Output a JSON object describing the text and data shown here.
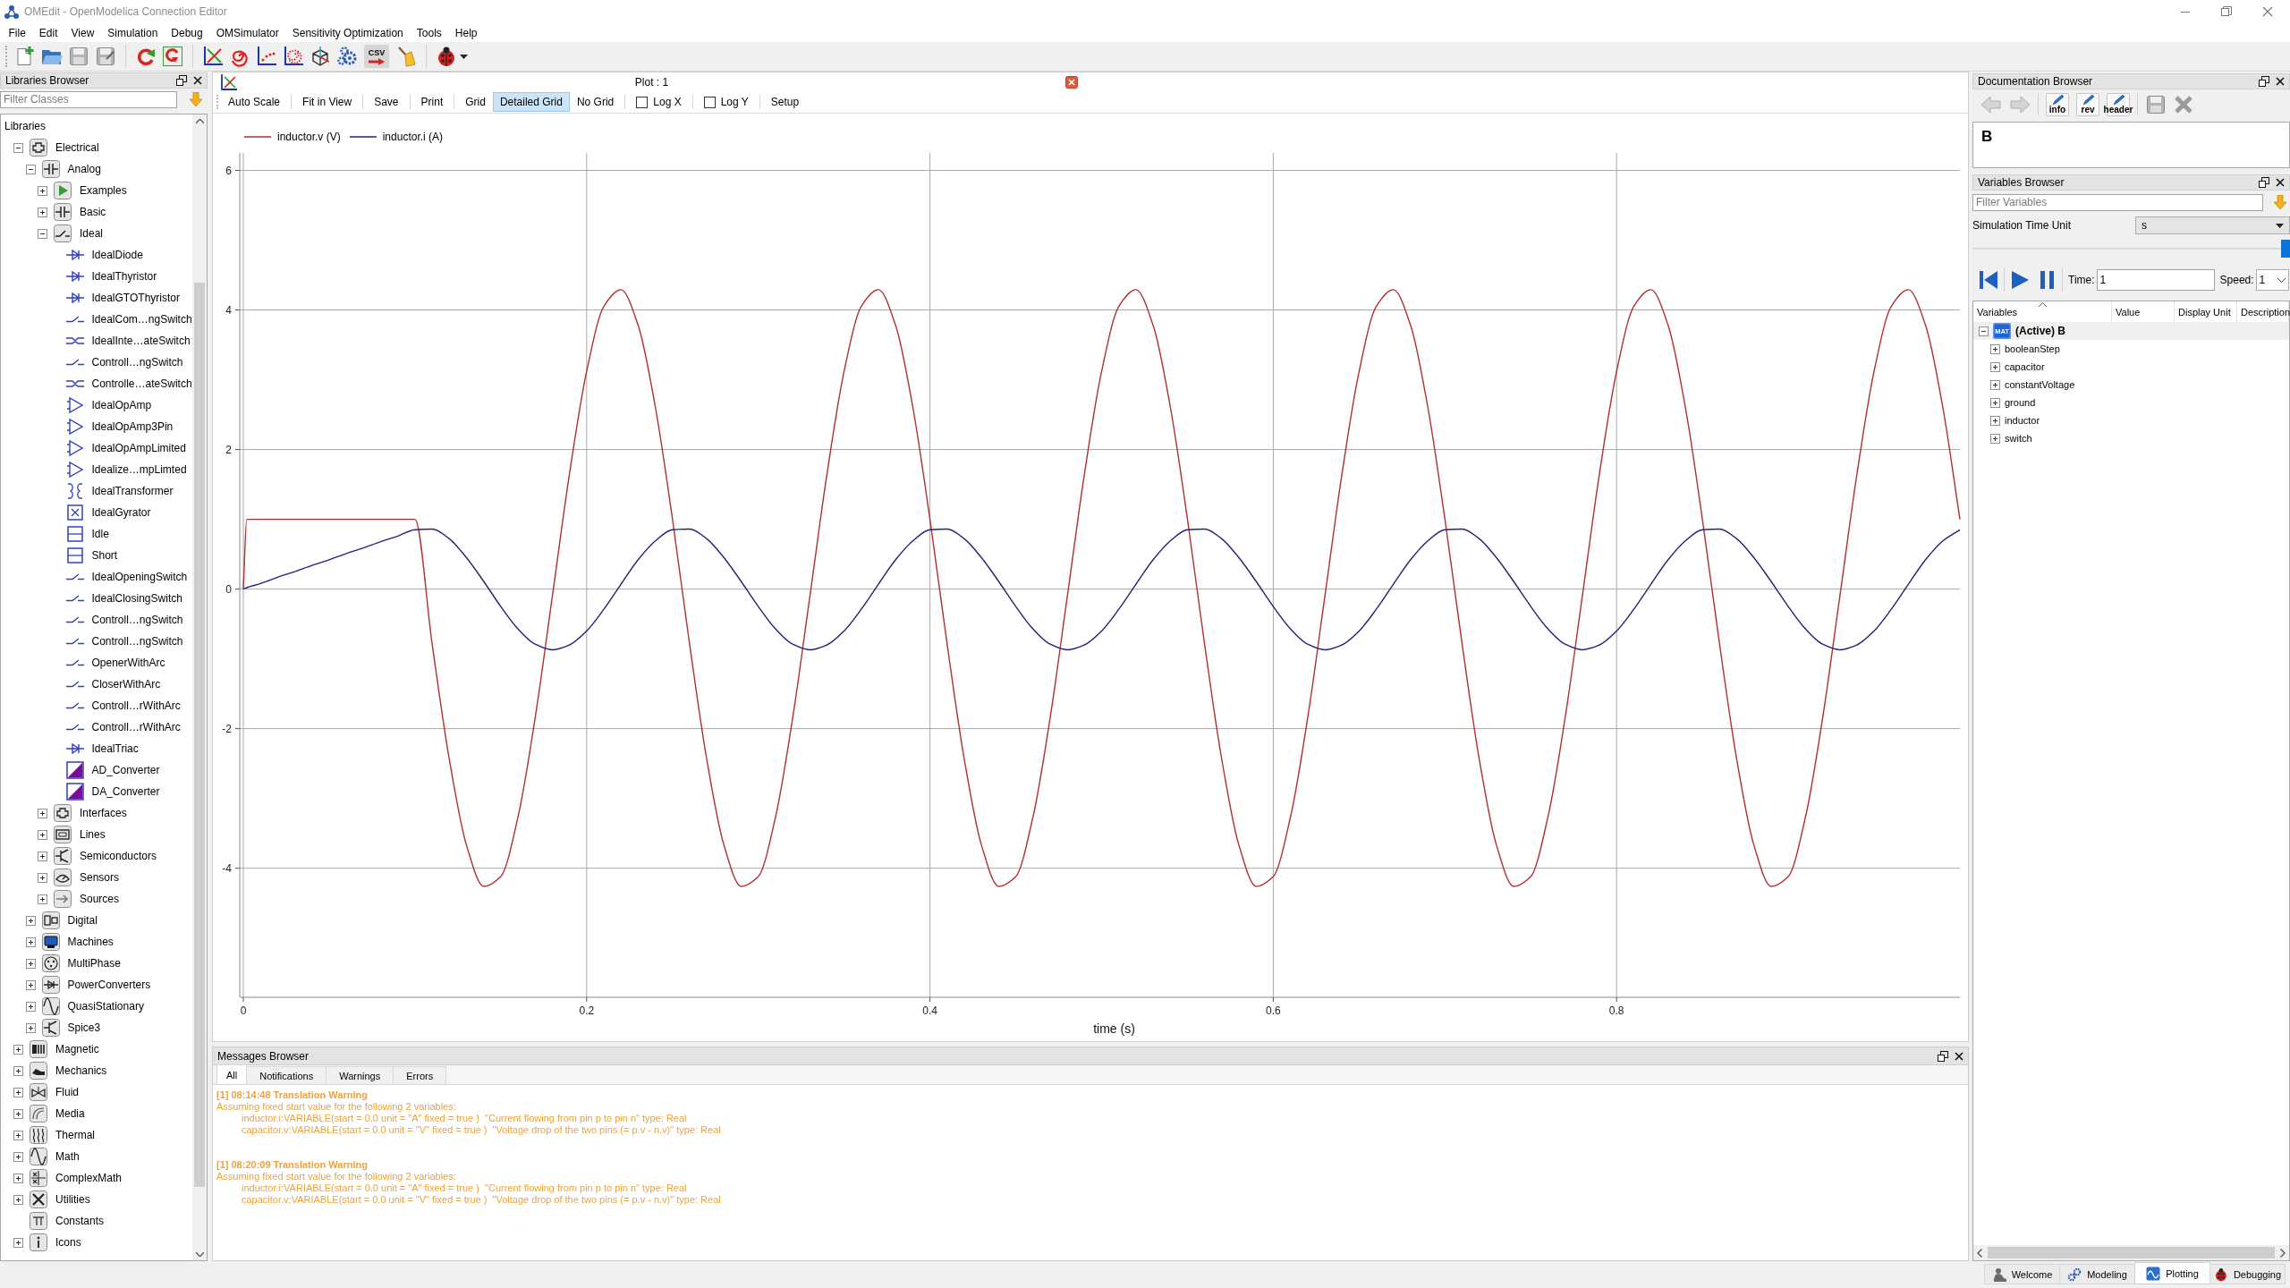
{
  "window": {
    "title": "OMEdit - OpenModelica Connection Editor"
  },
  "menu": [
    "File",
    "Edit",
    "View",
    "Simulation",
    "Debug",
    "OMSimulator",
    "Sensitivity Optimization",
    "Tools",
    "Help"
  ],
  "toolbar": {
    "export_icon_text": "CSV"
  },
  "libraries_browser": {
    "title": "Libraries Browser",
    "filter": {
      "placeholder": "Filter Classes"
    },
    "tree_header": "Libraries",
    "tree": [
      {
        "label": "Electrical",
        "expanded": true,
        "children": [
          {
            "label": "Analog",
            "expanded": true,
            "children": [
              {
                "label": "Examples",
                "expanded": false
              },
              {
                "label": "Basic",
                "expanded": false
              },
              {
                "label": "Ideal",
                "expanded": true,
                "children": [
                  {
                    "label": "IdealDiode"
                  },
                  {
                    "label": "IdealThyristor"
                  },
                  {
                    "label": "IdealGTOThyristor"
                  },
                  {
                    "label": "IdealCom…ngSwitch"
                  },
                  {
                    "label": "IdealInte…ateSwitch"
                  },
                  {
                    "label": "Controll…ngSwitch"
                  },
                  {
                    "label": "Controlle…ateSwitch"
                  },
                  {
                    "label": "IdealOpAmp"
                  },
                  {
                    "label": "IdealOpAmp3Pin"
                  },
                  {
                    "label": "IdealOpAmpLimited"
                  },
                  {
                    "label": "Idealize…mpLimted"
                  },
                  {
                    "label": "IdealTransformer"
                  },
                  {
                    "label": "IdealGyrator"
                  },
                  {
                    "label": "Idle"
                  },
                  {
                    "label": "Short"
                  },
                  {
                    "label": "IdealOpeningSwitch"
                  },
                  {
                    "label": "IdealClosingSwitch"
                  },
                  {
                    "label": "Controll…ngSwitch"
                  },
                  {
                    "label": "Controll…ngSwitch"
                  },
                  {
                    "label": "OpenerWithArc"
                  },
                  {
                    "label": "CloserWithArc"
                  },
                  {
                    "label": "Controll…rWithArc"
                  },
                  {
                    "label": "Controll…rWithArc"
                  },
                  {
                    "label": "IdealTriac"
                  },
                  {
                    "label": "AD_Converter"
                  },
                  {
                    "label": "DA_Converter"
                  }
                ]
              },
              {
                "label": "Interfaces",
                "expanded": false
              },
              {
                "label": "Lines",
                "expanded": false
              },
              {
                "label": "Semiconductors",
                "expanded": false
              },
              {
                "label": "Sensors",
                "expanded": false
              },
              {
                "label": "Sources",
                "expanded": false
              }
            ]
          },
          {
            "label": "Digital",
            "expanded": false
          },
          {
            "label": "Machines",
            "expanded": false
          },
          {
            "label": "MultiPhase",
            "expanded": false
          },
          {
            "label": "PowerConverters",
            "expanded": false
          },
          {
            "label": "QuasiStationary",
            "expanded": false
          },
          {
            "label": "Spice3",
            "expanded": false
          }
        ]
      },
      {
        "label": "Magnetic",
        "expanded": false
      },
      {
        "label": "Mechanics",
        "expanded": false
      },
      {
        "label": "Fluid",
        "expanded": false
      },
      {
        "label": "Media",
        "expanded": false
      },
      {
        "label": "Thermal",
        "expanded": false
      },
      {
        "label": "Math",
        "expanded": false
      },
      {
        "label": "ComplexMath",
        "expanded": false
      },
      {
        "label": "Utilities",
        "expanded": false
      },
      {
        "label": "Constants"
      },
      {
        "label": "Icons",
        "expanded": false
      }
    ]
  },
  "plot_window": {
    "title": "Plot : 1",
    "toolbar": [
      {
        "label": "Auto Scale",
        "kind": "button"
      },
      {
        "label": "Fit in View",
        "kind": "button"
      },
      {
        "label": "Save",
        "kind": "button"
      },
      {
        "label": "Print",
        "kind": "button"
      },
      {
        "label": "Grid",
        "kind": "option",
        "selected": false
      },
      {
        "label": "Detailed Grid",
        "kind": "option",
        "selected": true
      },
      {
        "label": "No Grid",
        "kind": "option",
        "selected": false
      },
      {
        "label": "Log X",
        "kind": "checkbox",
        "checked": false
      },
      {
        "label": "Log Y",
        "kind": "checkbox",
        "checked": false
      },
      {
        "label": "Setup",
        "kind": "button"
      }
    ],
    "chart_data": {
      "type": "line",
      "xlabel": "time (s)",
      "legend": "top",
      "grid": true,
      "xlim": [
        0,
        1
      ],
      "ylim": [
        -5.85,
        6.25
      ],
      "xticks": [
        0,
        0.2,
        0.4,
        0.6,
        0.8
      ],
      "yticks": [
        -4,
        -2,
        0,
        2,
        4,
        6
      ],
      "x": [
        0,
        0.002,
        0.01,
        0.02,
        0.03,
        0.04,
        0.05,
        0.06,
        0.07,
        0.08,
        0.09,
        0.1,
        0.11,
        0.12,
        0.13,
        0.14,
        0.15,
        0.16,
        0.17,
        0.18,
        0.19,
        0.2,
        0.21,
        0.22,
        0.23,
        0.24,
        0.25,
        0.26,
        0.27,
        0.28,
        0.29,
        0.3,
        0.31,
        0.32,
        0.33,
        0.34,
        0.35,
        0.36,
        0.37,
        0.38,
        0.39,
        0.4,
        0.41,
        0.42,
        0.43,
        0.44,
        0.45,
        0.46,
        0.47,
        0.48,
        0.49,
        0.5,
        0.51,
        0.52,
        0.53,
        0.54,
        0.55,
        0.56,
        0.57,
        0.58,
        0.59,
        0.6,
        0.61,
        0.62,
        0.63,
        0.64,
        0.65,
        0.66,
        0.67,
        0.68,
        0.69,
        0.7,
        0.71,
        0.72,
        0.73,
        0.74,
        0.75,
        0.76,
        0.77,
        0.78,
        0.79,
        0.8,
        0.81,
        0.82,
        0.83,
        0.84,
        0.85,
        0.86,
        0.87,
        0.88,
        0.89,
        0.9,
        0.91,
        0.92,
        0.93,
        0.94,
        0.95,
        0.96,
        0.97,
        0.98,
        0.99,
        1
      ],
      "series": [
        {
          "name": "inductor.v (V)",
          "color": "#b03030",
          "values": [
            0,
            1,
            1,
            1,
            1,
            1,
            1,
            1,
            1,
            1,
            1,
            1,
            -0.79,
            -2.44,
            -3.67,
            -4.26,
            -4.12,
            -3.27,
            -1.85,
            -0.11,
            1.65,
            3.12,
            4.05,
            4.29,
            3.78,
            2.61,
            1,
            -0.79,
            -2.44,
            -3.67,
            -4.26,
            -4.12,
            -3.27,
            -1.85,
            -0.11,
            1.65,
            3.12,
            4.05,
            4.29,
            3.78,
            2.61,
            1,
            -0.79,
            -2.44,
            -3.67,
            -4.26,
            -4.12,
            -3.27,
            -1.85,
            -0.11,
            1.65,
            3.12,
            4.05,
            4.29,
            3.78,
            2.61,
            1,
            -0.79,
            -2.44,
            -3.67,
            -4.26,
            -4.12,
            -3.27,
            -1.85,
            -0.11,
            1.65,
            3.12,
            4.05,
            4.29,
            3.78,
            2.61,
            1,
            -0.79,
            -2.44,
            -3.67,
            -4.26,
            -4.12,
            -3.27,
            -1.85,
            -0.11,
            1.65,
            3.12,
            4.05,
            4.29,
            3.78,
            2.61,
            1,
            -0.79,
            -2.44,
            -3.67,
            -4.26,
            -4.12,
            -3.27,
            -1.85,
            -0.11,
            1.65,
            3.12,
            4.05,
            4.29,
            3.78,
            2.61,
            1
          ]
        },
        {
          "name": "inductor.i (A)",
          "color": "#22227a",
          "values": [
            0,
            0.02,
            0.08,
            0.17,
            0.25,
            0.34,
            0.42,
            0.51,
            0.59,
            0.68,
            0.76,
            0.85,
            0.86,
            0.72,
            0.45,
            0.11,
            -0.25,
            -0.57,
            -0.79,
            -0.87,
            -0.8,
            -0.6,
            -0.29,
            0.07,
            0.42,
            0.69,
            0.85,
            0.86,
            0.72,
            0.45,
            0.11,
            -0.25,
            -0.57,
            -0.79,
            -0.87,
            -0.8,
            -0.6,
            -0.29,
            0.07,
            0.42,
            0.69,
            0.85,
            0.86,
            0.72,
            0.45,
            0.11,
            -0.25,
            -0.57,
            -0.79,
            -0.87,
            -0.8,
            -0.6,
            -0.29,
            0.07,
            0.42,
            0.69,
            0.85,
            0.86,
            0.72,
            0.45,
            0.11,
            -0.25,
            -0.57,
            -0.79,
            -0.87,
            -0.8,
            -0.6,
            -0.29,
            0.07,
            0.42,
            0.69,
            0.85,
            0.86,
            0.72,
            0.45,
            0.11,
            -0.25,
            -0.57,
            -0.79,
            -0.87,
            -0.8,
            -0.6,
            -0.29,
            0.07,
            0.42,
            0.69,
            0.85,
            0.86,
            0.72,
            0.45,
            0.11,
            -0.25,
            -0.57,
            -0.79,
            -0.87,
            -0.8,
            -0.6,
            -0.29,
            0.07,
            0.42,
            0.69,
            0.85
          ]
        }
      ]
    }
  },
  "messages_browser": {
    "title": "Messages Browser",
    "tabs": [
      {
        "label": "All",
        "selected": true
      },
      {
        "label": "Notifications",
        "selected": false
      },
      {
        "label": "Warnings",
        "selected": false
      },
      {
        "label": "Errors",
        "selected": false
      }
    ],
    "messages": [
      {
        "kind": "warning",
        "title": "[1] 08:14:48 Translation Warning",
        "summary": "Assuming fixed start value for the following 2 variables:",
        "details": [
          "inductor.i:VARIABLE(start = 0.0 unit = \"A\" fixed = true )  \"Current flowing from pin p to pin n\" type: Real",
          "capacitor.v:VARIABLE(start = 0.0 unit = \"V\" fixed = true )  \"Voltage drop of the two pins (= p.v - n.v)\" type: Real"
        ]
      },
      {
        "kind": "warning",
        "title": "[1] 08:20:09 Translation Warning",
        "summary": "Assuming fixed start value for the following 2 variables:",
        "details": [
          "inductor.i:VARIABLE(start = 0.0 unit = \"A\" fixed = true )  \"Current flowing from pin p to pin n\" type: Real",
          "capacitor.v:VARIABLE(start = 0.0 unit = \"V\" fixed = true )  \"Voltage drop of the two pins (= p.v - n.v)\" type: Real"
        ]
      }
    ]
  },
  "documentation_browser": {
    "title": "Documentation Browser",
    "edit_buttons": [
      {
        "label": "info"
      },
      {
        "label": "rev"
      },
      {
        "label": "header"
      }
    ],
    "content": "B"
  },
  "variables_browser": {
    "title": "Variables Browser",
    "filter": {
      "placeholder": "Filter Variables"
    },
    "time_unit": {
      "label": "Simulation Time Unit",
      "value": "s"
    },
    "time_slider": {
      "level": 1
    },
    "time": {
      "label": "Time:",
      "value": "1"
    },
    "speed": {
      "label": "Speed:",
      "value": "1"
    },
    "columns": [
      "Variables",
      "Value",
      "Display Unit",
      "Description"
    ],
    "tree": [
      {
        "label": "(Active) B",
        "file_type": "MAT",
        "expanded": true,
        "children": [
          {
            "label": "booleanStep",
            "expanded": false
          },
          {
            "label": "capacitor",
            "expanded": false
          },
          {
            "label": "constantVoltage",
            "expanded": false
          },
          {
            "label": "ground",
            "expanded": false
          },
          {
            "label": "inductor",
            "expanded": false
          },
          {
            "label": "switch",
            "expanded": false
          }
        ]
      }
    ]
  },
  "status_bar": {
    "perspectives": [
      {
        "label": "Welcome",
        "selected": false
      },
      {
        "label": "Modeling",
        "selected": false
      },
      {
        "label": "Plotting",
        "selected": true
      },
      {
        "label": "Debugging",
        "selected": false
      }
    ]
  }
}
